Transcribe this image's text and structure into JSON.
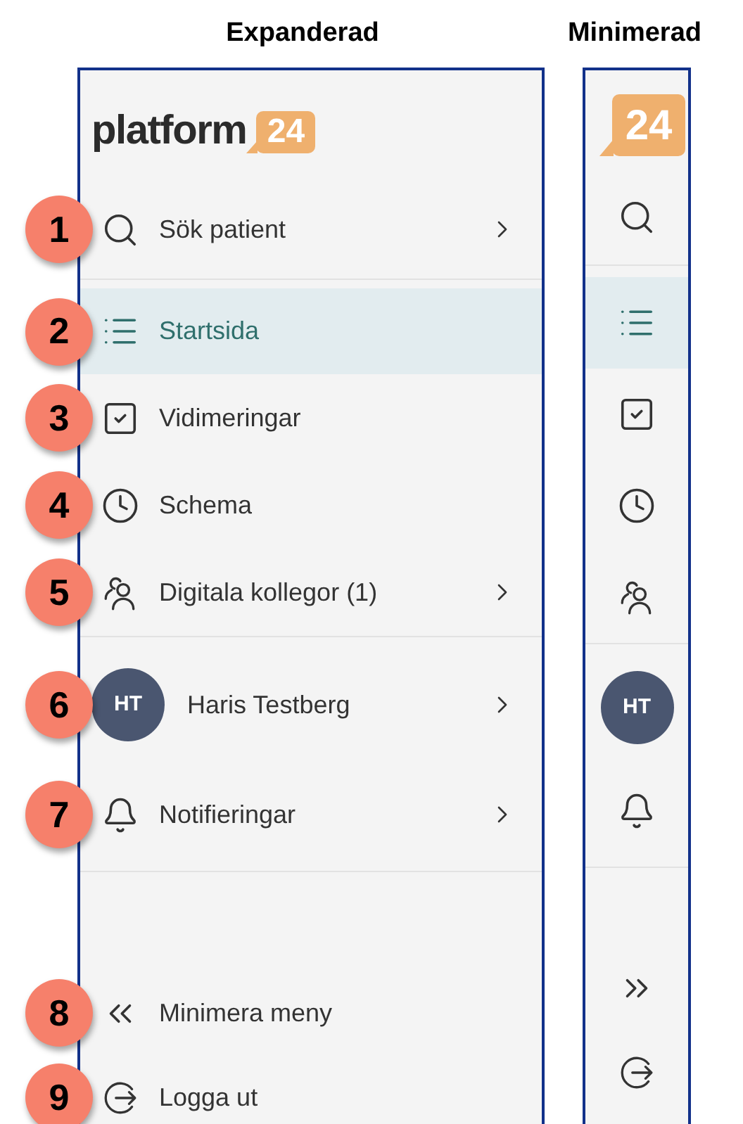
{
  "headings": {
    "expanded": "Expanderad",
    "minimized": "Minimerad"
  },
  "expanded": {
    "logo": {
      "text": "platform",
      "mark": "24"
    },
    "groups": [
      [
        {
          "kind": "nav",
          "badge": "1",
          "label": "Sök patient",
          "submenu": true,
          "selected": false
        }
      ],
      [
        {
          "kind": "nav",
          "badge": "2",
          "label": "Startsida",
          "submenu": false,
          "selected": true
        },
        {
          "kind": "nav",
          "badge": "3",
          "label": "Vidimeringar",
          "submenu": false,
          "selected": false
        },
        {
          "kind": "nav",
          "badge": "4",
          "label": "Schema",
          "submenu": false,
          "selected": false
        },
        {
          "kind": "nav",
          "badge": "5",
          "label": "Digitala kollegor (1)",
          "submenu": true,
          "selected": false
        }
      ],
      [
        {
          "kind": "user",
          "badge": "6",
          "initials": "HT",
          "label": "Haris Testberg",
          "submenu": true,
          "selected": false
        },
        {
          "kind": "nav",
          "badge": "7",
          "label": "Notifieringar",
          "submenu": true,
          "selected": false
        }
      ],
      [
        {
          "kind": "nav",
          "badge": "8",
          "label": "Minimera meny",
          "submenu": false,
          "selected": false
        },
        {
          "kind": "nav",
          "badge": "9",
          "label": "Logga ut",
          "submenu": false,
          "selected": false
        }
      ]
    ]
  },
  "minimized": {
    "logo": {
      "mark": "24"
    },
    "groups": [
      [
        {
          "kind": "icon",
          "selected": false
        }
      ],
      [
        {
          "kind": "icon",
          "selected": true
        },
        {
          "kind": "icon",
          "selected": false
        },
        {
          "kind": "icon",
          "selected": false
        },
        {
          "kind": "icon",
          "selected": false
        }
      ],
      [
        {
          "kind": "user",
          "initials": "HT",
          "selected": false
        },
        {
          "kind": "icon",
          "selected": false
        }
      ],
      [
        {
          "kind": "icon",
          "selected": false
        },
        {
          "kind": "icon",
          "selected": false
        }
      ]
    ]
  }
}
